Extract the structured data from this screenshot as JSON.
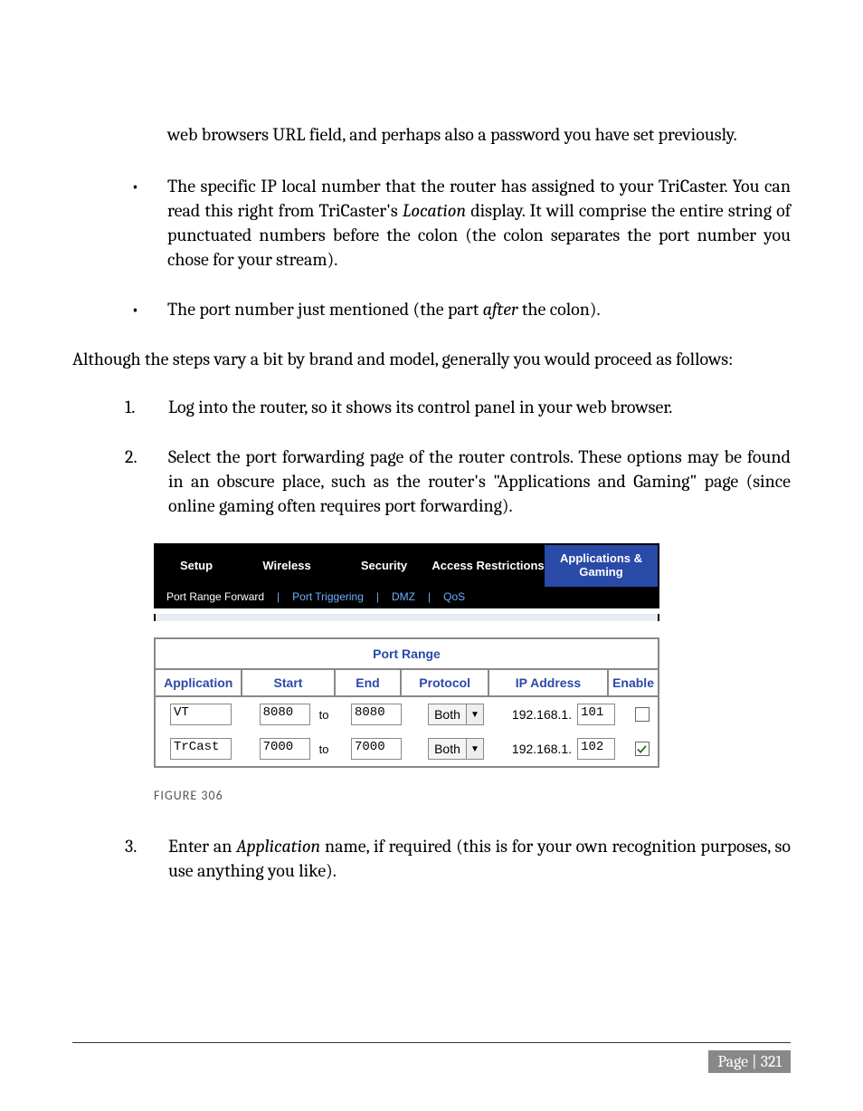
{
  "top_continuation": "web browsers URL field, and perhaps also a password you have set previously.",
  "bullets": [
    {
      "pre": "The specific IP local number that the router has assigned to your TriCaster. You can read this right from TriCaster's ",
      "em": "Location",
      "post": " display.  It will comprise the entire string of punctuated numbers before the colon (the colon separates the port number you chose for your stream)."
    },
    {
      "pre": "The port number just mentioned (the part ",
      "em": "after",
      "post": " the colon)."
    }
  ],
  "bridge": "Although the steps vary a bit by brand and model, generally you would proceed as follows:",
  "steps12": [
    "Log into the router, so it shows its control panel in your web browser.",
    "Select the port forwarding page of the router controls.  These options may be found in an obscure place, such as the router's \"Applications and Gaming\" page (since online gaming often requires port forwarding)."
  ],
  "nav": {
    "tabs": [
      "Setup",
      "Wireless",
      "Security",
      "Access Restrictions",
      "Applications & Gaming"
    ],
    "sub": [
      "Port Range Forward",
      "Port Triggering",
      "DMZ",
      "QoS"
    ]
  },
  "port_table": {
    "title": "Port Range",
    "headers": [
      "Application",
      "Start",
      "End",
      "Protocol",
      "IP Address",
      "Enable"
    ],
    "ip_prefix": "192.168.1.",
    "to_label": "to",
    "proto_value": "Both",
    "rows": [
      {
        "app": "VT",
        "start": "8080",
        "end": "8080",
        "ip": "101",
        "checked": false
      },
      {
        "app": "TrCast",
        "start": "7000",
        "end": "7000",
        "ip": "102",
        "checked": true
      }
    ]
  },
  "figure_caption": "FIGURE 306",
  "step3": {
    "pre": "Enter an ",
    "em": "Application",
    "post": " name, if required (this is for your own recognition purposes, so use anything you like)."
  },
  "footer": {
    "label": "Page | ",
    "num": "321"
  }
}
